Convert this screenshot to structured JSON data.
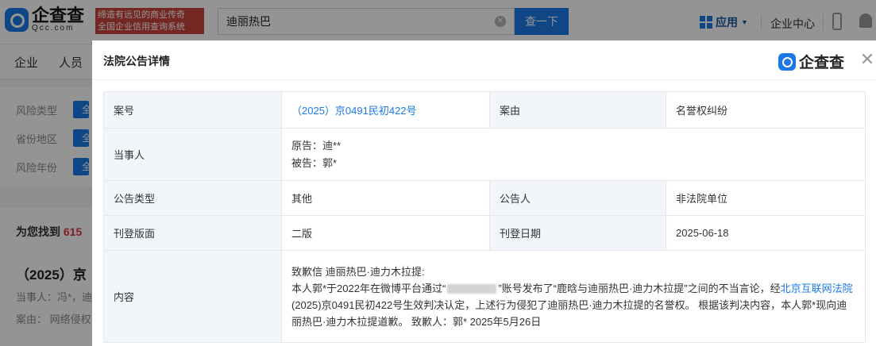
{
  "header": {
    "logo_text": "企查查",
    "logo_sub": "Qcc.com",
    "slogan_line1": "缔造有远见的商业传奇",
    "slogan_line2": "全国企业信用查询系统",
    "search_value": "迪丽热巴",
    "search_button": "查一下",
    "apps_label": "应用",
    "enterprise_center": "企业中心"
  },
  "nav": {
    "items": [
      "企业",
      "人员"
    ]
  },
  "filters": {
    "rows": [
      {
        "label": "风险类型",
        "chip": "全"
      },
      {
        "label": "省份地区",
        "chip": "全"
      },
      {
        "label": "风险年份",
        "chip": "全"
      }
    ]
  },
  "results": {
    "found_prefix": "为您找到",
    "found_count": "615",
    "first_title": "（2025）京",
    "party_line": "当事人：冯*，迪",
    "cause_line": "案由：  网络侵权"
  },
  "modal": {
    "title": "法院公告详情",
    "logo_text": "企查查",
    "fields": {
      "case_no_label": "案号",
      "case_no_value": "（2025）京0491民初422号",
      "cause_label": "案由",
      "cause_value": "名誉权纠纷",
      "party_label": "当事人",
      "plaintiff": "原告：迪**",
      "defendant": "被告：郭*",
      "type_label": "公告类型",
      "type_value": "其他",
      "announcer_label": "公告人",
      "announcer_value": "非法院单位",
      "layout_label": "刊登版面",
      "layout_value": "二版",
      "date_label": "刊登日期",
      "date_value": "2025-06-18",
      "content_label": "内容",
      "content_line1": "致歉信 迪丽热巴·迪力木拉提:",
      "content_p1": "本人郭*于2022年在微博平台通过“",
      "content_p2": "”账号发布了“鹿晗与迪丽热巴·迪力木拉提”之间的不当言论，经",
      "content_link": "北京互联网法院",
      "content_p3": "(2025)京0491民初422号生效判决认定，上述行为侵犯了迪丽热巴·迪力木拉提的名誉权。 根据该判决内容，本人郭*现向迪丽热巴·迪力木拉提道歉。 致歉人：郭* 2025年5月26日"
    }
  },
  "colors": {
    "brand_blue": "#1a79e6",
    "slogan_red": "#c9443c",
    "label_bg": "#f2f6fb",
    "count_red": "#d9363e"
  },
  "icons": [
    "qcc-logo-icon",
    "clear-icon",
    "grid-icon",
    "caret-down-icon",
    "phone-icon",
    "bell-icon",
    "close-icon"
  ]
}
